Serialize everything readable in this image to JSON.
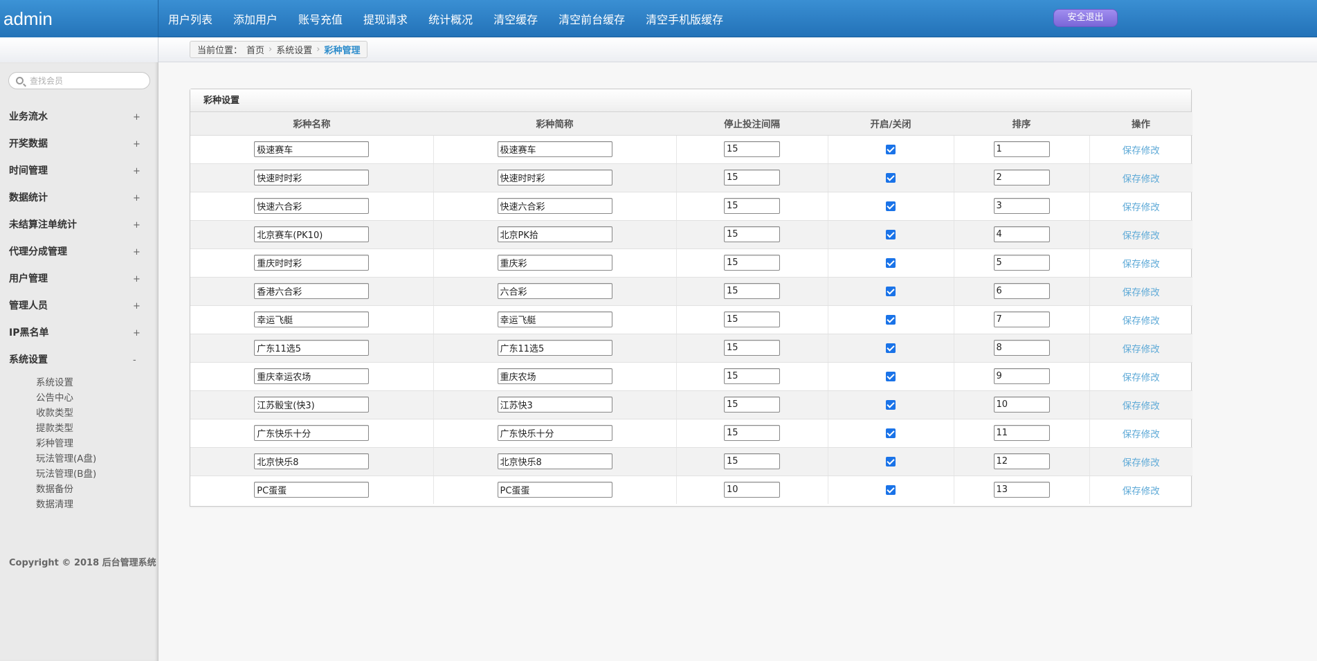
{
  "header": {
    "brand": "admin",
    "nav": [
      "用户列表",
      "添加用户",
      "账号充值",
      "提现请求",
      "统计概况",
      "清空缓存",
      "清空前台缓存",
      "清空手机版缓存"
    ],
    "logout_label": "安全退出"
  },
  "breadcrumb": {
    "items": [
      "当前位置：",
      "首页",
      "系统设置"
    ],
    "current": "彩种管理"
  },
  "sidebar": {
    "search_placeholder": "查找会员",
    "menu": [
      {
        "label": "业务流水",
        "toggle": "+"
      },
      {
        "label": "开奖数据",
        "toggle": "+"
      },
      {
        "label": "时间管理",
        "toggle": "+"
      },
      {
        "label": "数据统计",
        "toggle": "+"
      },
      {
        "label": "未结算注单统计",
        "toggle": "+"
      },
      {
        "label": "代理分成管理",
        "toggle": "+"
      },
      {
        "label": "用户管理",
        "toggle": "+"
      },
      {
        "label": "管理人员",
        "toggle": "+"
      },
      {
        "label": "IP黑名单",
        "toggle": "+"
      },
      {
        "label": "系统设置",
        "toggle": "-"
      }
    ],
    "submenu": [
      "系统设置",
      "公告中心",
      "收款类型",
      "提款类型",
      "彩种管理",
      "玩法管理(A盘)",
      "玩法管理(B盘)",
      "数据备份",
      "数据清理"
    ],
    "copyright": "Copyright © 2018 后台管理系统"
  },
  "panel": {
    "title": "彩种设置",
    "columns": [
      "彩种名称",
      "彩种简称",
      "停止投注间隔",
      "开启/关闭",
      "排序",
      "操作"
    ],
    "action_label": "保存修改",
    "rows": [
      {
        "name": "极速赛车",
        "short": "极速赛车",
        "interval": "15",
        "enabled": true,
        "order": "1"
      },
      {
        "name": "快速时时彩",
        "short": "快速时时彩",
        "interval": "15",
        "enabled": true,
        "order": "2"
      },
      {
        "name": "快速六合彩",
        "short": "快速六合彩",
        "interval": "15",
        "enabled": true,
        "order": "3"
      },
      {
        "name": "北京赛车(PK10)",
        "short": "北京PK拾",
        "interval": "15",
        "enabled": true,
        "order": "4"
      },
      {
        "name": "重庆时时彩",
        "short": "重庆彩",
        "interval": "15",
        "enabled": true,
        "order": "5"
      },
      {
        "name": "香港六合彩",
        "short": "六合彩",
        "interval": "15",
        "enabled": true,
        "order": "6"
      },
      {
        "name": "幸运飞艇",
        "short": "幸运飞艇",
        "interval": "15",
        "enabled": true,
        "order": "7"
      },
      {
        "name": "广东11选5",
        "short": "广东11选5",
        "interval": "15",
        "enabled": true,
        "order": "8"
      },
      {
        "name": "重庆幸运农场",
        "short": "重庆农场",
        "interval": "15",
        "enabled": true,
        "order": "9"
      },
      {
        "name": "江苏骰宝(快3)",
        "short": "江苏快3",
        "interval": "15",
        "enabled": true,
        "order": "10"
      },
      {
        "name": "广东快乐十分",
        "short": "广东快乐十分",
        "interval": "15",
        "enabled": true,
        "order": "11"
      },
      {
        "name": "北京快乐8",
        "short": "北京快乐8",
        "interval": "15",
        "enabled": true,
        "order": "12"
      },
      {
        "name": "PC蛋蛋",
        "short": "PC蛋蛋",
        "interval": "10",
        "enabled": true,
        "order": "13"
      }
    ]
  }
}
